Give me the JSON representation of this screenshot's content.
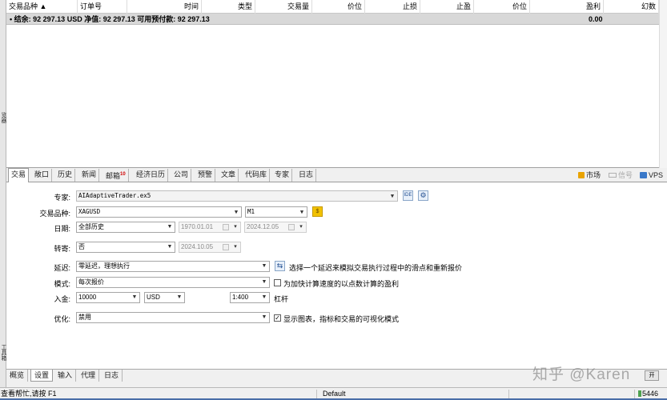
{
  "left_strip": [
    "览器",
    "工具箱"
  ],
  "columns": [
    {
      "label": "交易品种 ▲"
    },
    {
      "label": "订单号"
    },
    {
      "label": "时间"
    },
    {
      "label": "类型"
    },
    {
      "label": "交易量"
    },
    {
      "label": "价位"
    },
    {
      "label": "止损"
    },
    {
      "label": "止盈"
    },
    {
      "label": "价位"
    },
    {
      "label": "盈利"
    },
    {
      "label": "幻数"
    }
  ],
  "summary": {
    "text": "• 结余: 92 297.13 USD  净值: 92 297.13  可用预付款: 92 297.13",
    "profit": "0.00"
  },
  "tabs_top": [
    {
      "label": "交易"
    },
    {
      "label": "敞口"
    },
    {
      "label": "历史"
    },
    {
      "label": "新闻"
    },
    {
      "label": "邮箱",
      "badge": "10"
    },
    {
      "label": "经济日历"
    },
    {
      "label": "公司"
    },
    {
      "label": "预警"
    },
    {
      "label": "文章"
    },
    {
      "label": "代码库"
    },
    {
      "label": "专家"
    },
    {
      "label": "日志"
    }
  ],
  "right_tools": {
    "market": "市场",
    "signals": "信号",
    "vps": "VPS"
  },
  "tester": {
    "expert_label": "专家:",
    "expert_value": "AIAdaptiveTrader.ex5",
    "expert_btn_icon": "IDE",
    "symbol_label": "交易品种:",
    "symbol_value": "XAGUSD",
    "timeframe_value": "M1",
    "symbol_btn_icon": "$",
    "date_label": "日期:",
    "date_value": "全部历史",
    "date_from": "1970.01.01",
    "date_to": "2024.12.05",
    "forward_label": "转寄:",
    "forward_value": "否",
    "forward_date": "2024.10.05",
    "delay_label": "延迟:",
    "delay_value": "零延迟，理想执行",
    "delay_hint": "选择一个延迟来模拟交易执行过程中的滑点和重新报价",
    "model_label": "模式:",
    "model_value": "每次报价",
    "model_check_label": "为加快计算速度的以点数计算的盈利",
    "deposit_label": "入金:",
    "deposit_value": "10000",
    "currency_value": "USD",
    "leverage_value": "1:400",
    "leverage_label": "杠杆",
    "opt_label": "优化:",
    "opt_value": "禁用",
    "visual_label": "显示图表，指标和交易的可视化模式",
    "visual_checked": true,
    "model_checked": false
  },
  "tabs_bottom": [
    {
      "label": "概览"
    },
    {
      "label": "设置"
    },
    {
      "label": "输入"
    },
    {
      "label": "代理"
    },
    {
      "label": "日志"
    }
  ],
  "start_btn": "开",
  "status": {
    "help": "查看帮忙,请按 F1",
    "profile": "Default",
    "traffic": "5446"
  },
  "watermark": "知乎 @Karen"
}
